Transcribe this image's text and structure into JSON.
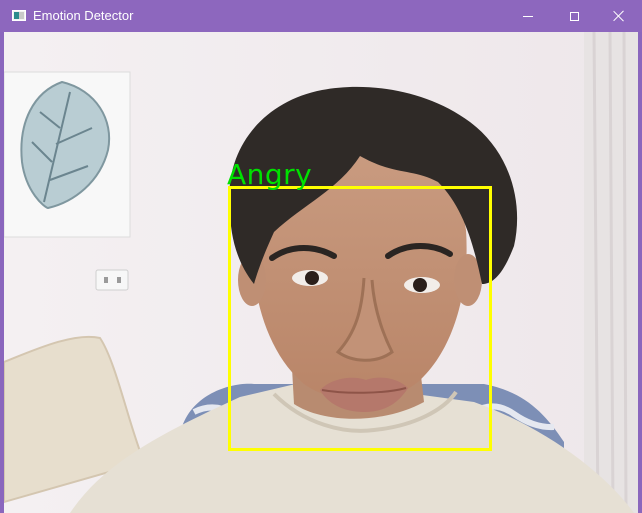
{
  "window": {
    "title": "Emotion Detector",
    "controls": {
      "minimize_icon": "minimize-icon",
      "maximize_icon": "maximize-icon",
      "close_icon": "close-icon"
    },
    "titlebar_color": "#8d67be"
  },
  "detection": {
    "label": "Angry",
    "label_color": "#00e000",
    "box_color": "#ffff00"
  }
}
